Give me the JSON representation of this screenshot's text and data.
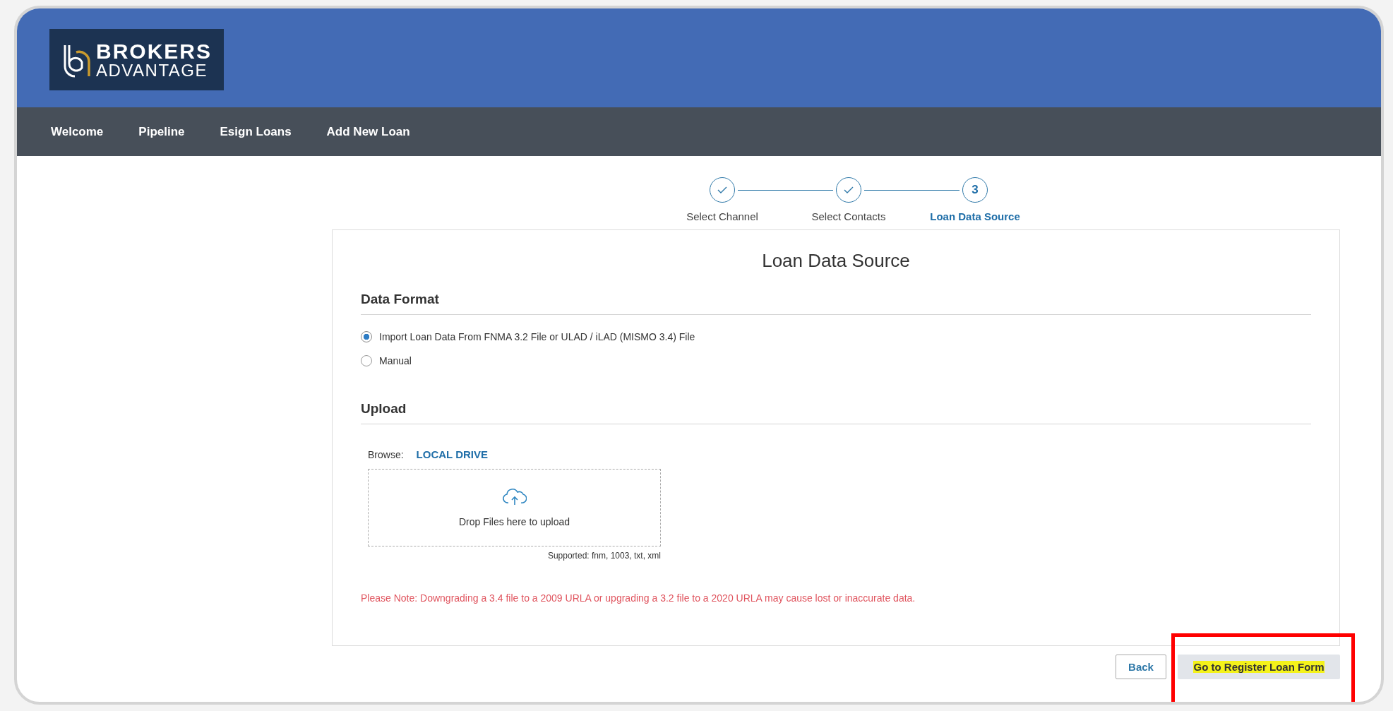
{
  "logo": {
    "line_1": "BROKERS",
    "line_2": "ADVANTAGE"
  },
  "nav": [
    {
      "label": "Welcome"
    },
    {
      "label": "Pipeline"
    },
    {
      "label": "Esign Loans"
    },
    {
      "label": "Add New Loan"
    }
  ],
  "steps": [
    {
      "label": "Select Channel",
      "completed": true,
      "selected": false
    },
    {
      "label": "Select Contacts",
      "completed": true,
      "selected": false
    },
    {
      "label": "Loan Data Source",
      "completed": false,
      "number": "3",
      "selected": true
    }
  ],
  "card": {
    "title": "Loan Data Source",
    "data_format": {
      "heading": "Data Format",
      "options": [
        {
          "label": "Import Loan Data From FNMA 3.2 File or ULAD / iLAD (MISMO 3.4) File",
          "selected": true
        },
        {
          "label": "Manual",
          "selected": false
        }
      ]
    },
    "upload": {
      "heading": "Upload",
      "browse_label": "Browse:",
      "browse_link": "LOCAL DRIVE",
      "drop_text": "Drop Files here to upload",
      "supported": "Supported: fnm, 1003, txt, xml"
    },
    "note": "Please Note: Downgrading a 3.4 file to a 2009 URLA or upgrading a 3.2 file to a 2020 URLA may cause lost or inaccurate data."
  },
  "buttons": [
    {
      "label": "Back",
      "kind": "secondary",
      "highlighted": false,
      "annotated": false
    },
    {
      "label": "Go to Register Loan Form",
      "kind": "primary",
      "highlighted": true,
      "annotated": true
    }
  ]
}
